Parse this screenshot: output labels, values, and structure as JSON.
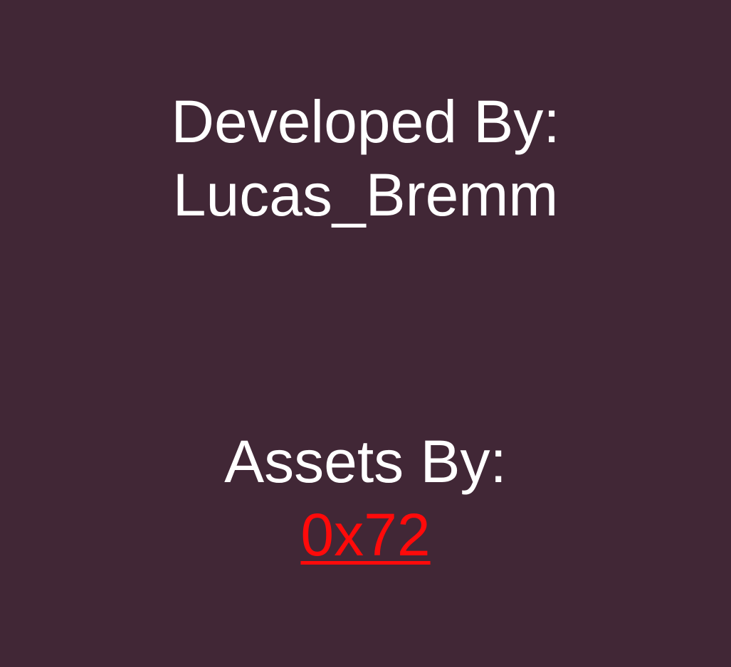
{
  "colors": {
    "background": "#412736",
    "text": "#ffffff",
    "link": "#ff0a0a"
  },
  "credits": {
    "developer": {
      "heading": "Developed By:",
      "name": "Lucas_Bremm"
    },
    "assets": {
      "heading": "Assets By:",
      "name": "0x72"
    }
  }
}
